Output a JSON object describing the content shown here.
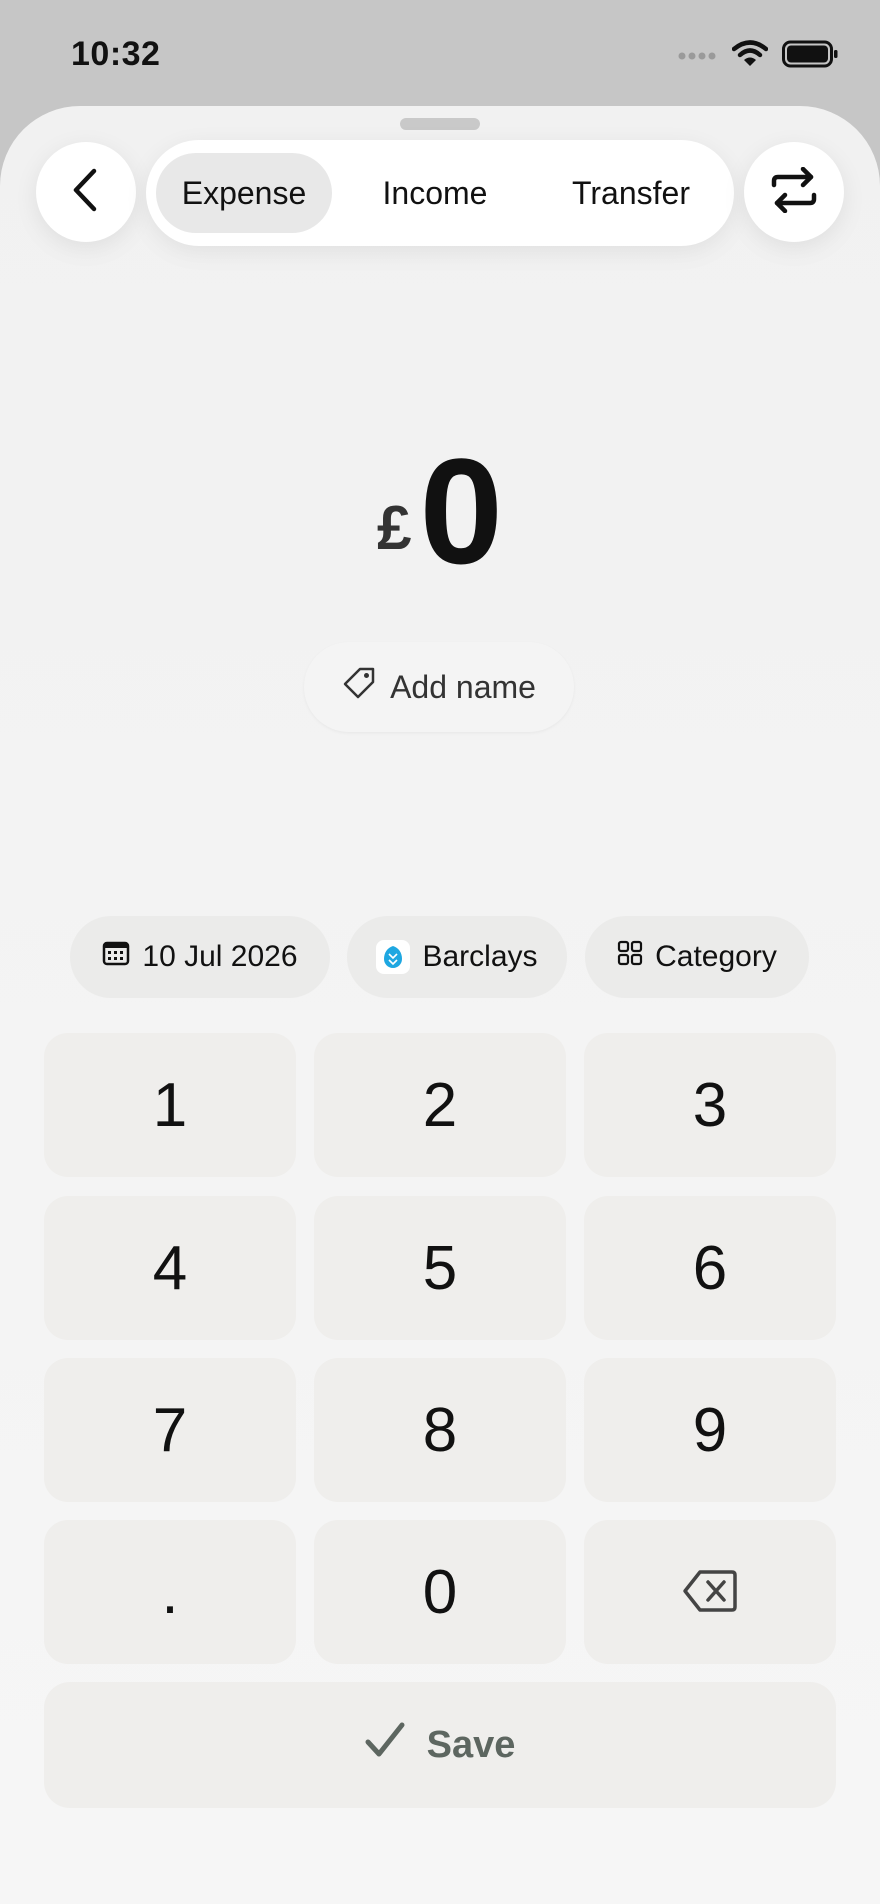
{
  "status_bar": {
    "time": "10:32"
  },
  "header": {
    "tabs": [
      {
        "label": "Expense",
        "active": true
      },
      {
        "label": "Income",
        "active": false
      },
      {
        "label": "Transfer",
        "active": false
      }
    ]
  },
  "amount": {
    "currency": "£",
    "value": "0"
  },
  "name_button": {
    "label": "Add name"
  },
  "chips": {
    "date": "10 Jul 2026",
    "account": "Barclays",
    "category": "Category"
  },
  "keypad": {
    "keys": [
      "1",
      "2",
      "3",
      "4",
      "5",
      "6",
      "7",
      "8",
      "9",
      ".",
      "0"
    ]
  },
  "save_button": {
    "label": "Save"
  },
  "colors": {
    "accent_save": "#5d6660",
    "key_bg": "#efeeec",
    "bank_logo": "#1ea7e1"
  }
}
